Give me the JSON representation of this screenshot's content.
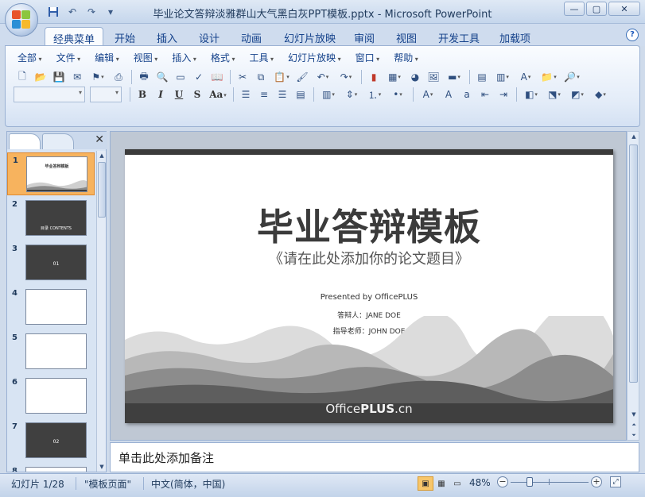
{
  "window": {
    "title": "毕业论文答辩淡雅群山大气黑白灰PPT模板.pptx - Microsoft PowerPoint",
    "controls": {
      "minimize": "—",
      "maximize": "▢",
      "close": "✕"
    }
  },
  "quick_access": [
    "save-icon",
    "undo-icon",
    "redo-icon",
    "customize-icon"
  ],
  "ribbon_tabs": [
    "经典菜单",
    "开始",
    "插入",
    "设计",
    "动画",
    "幻灯片放映",
    "审阅",
    "视图",
    "开发工具",
    "加载项"
  ],
  "active_tab": "经典菜单",
  "classic_menu": [
    "全部",
    "文件",
    "编辑",
    "视图",
    "插入",
    "格式",
    "工具",
    "幻灯片放映",
    "窗口",
    "帮助"
  ],
  "format_buttons": {
    "bold": "B",
    "italic": "I",
    "underline": "U",
    "strike": "S",
    "case": "Aa"
  },
  "left_pane": {
    "thumbnails": [
      {
        "num": "1",
        "title": "毕业答辩模板",
        "style": "light",
        "selected": true
      },
      {
        "num": "2",
        "title": "目录 CONTENTS",
        "style": "dark"
      },
      {
        "num": "3",
        "title": "01",
        "style": "dark"
      },
      {
        "num": "4",
        "title": "",
        "style": "light"
      },
      {
        "num": "5",
        "title": "",
        "style": "light"
      },
      {
        "num": "6",
        "title": "",
        "style": "light"
      },
      {
        "num": "7",
        "title": "02",
        "style": "dark"
      },
      {
        "num": "8",
        "title": "",
        "style": "light"
      }
    ]
  },
  "slide": {
    "title": "毕业答辩模板",
    "subtitle": "《请在此处添加你的论文题目》",
    "presented_by": "Presented by OfficePLUS",
    "presenter": "答辩人：JANE DOE",
    "advisor": "指导老师：JOHN DOE",
    "brand_prefix": "Office",
    "brand_bold": "PLUS",
    "brand_suffix": ".cn"
  },
  "notes": {
    "placeholder": "单击此处添加备注"
  },
  "status": {
    "slide_counter": "幻灯片 1/28",
    "theme": "\"模板页面\"",
    "language": "中文(简体，中国)",
    "zoom": "48%",
    "zoom_fraction": 0.48
  },
  "colors": {
    "ribbon_bg": "#dfe9f5",
    "selected_thumb": "#f7b35e",
    "slide_dark": "#3b3b3b"
  }
}
